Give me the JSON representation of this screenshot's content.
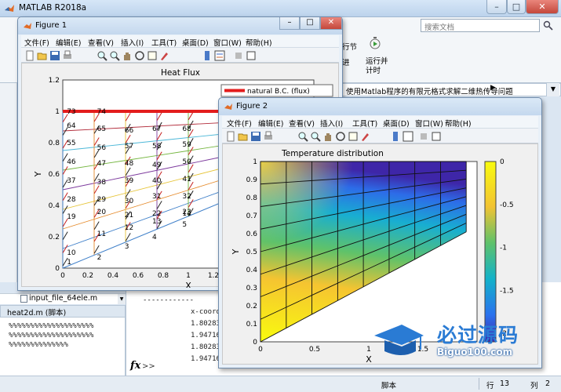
{
  "app": {
    "title": "MATLAB R2018a",
    "search_placeholder": "搜索文档",
    "ribbon_run_section": "行节",
    "ribbon_advance": "进",
    "ribbon_run_time_1": "运行并",
    "ribbon_run_time_2": "计时",
    "address_bar": "使用Matlab程序的有限元格式求解二维热传导问题",
    "file_item": "input_file_64ele.m",
    "editor_title": "heat2d.m (脚本)",
    "editor_lines": [
      "%%%%%%%%%%%%%%%%%%%%",
      "%%%%%%%%%%%%%%%%%%%%",
      "%%%%%%%%%%%%%%"
    ],
    "cmd_dashes": "------------",
    "cmd_lines": [
      "x-coord",
      "1.80283",
      "1.94716",
      "1.80283",
      "1.94716"
    ],
    "prompt": ">>",
    "status": {
      "mode": "脚本",
      "row_label": "行",
      "row": "13",
      "col_label": "列",
      "col": "2"
    }
  },
  "menus": [
    "文件(F)",
    "编辑(E)",
    "查看(V)",
    "插入(I)",
    "工具(T)",
    "桌面(D)",
    "窗口(W)",
    "帮助(H)"
  ],
  "figure1": {
    "window_title": "Figure 1",
    "chart_data": {
      "type": "quiver",
      "title": "Heat Flux",
      "xlabel": "X",
      "ylabel": "Y",
      "xlim": [
        0,
        2
      ],
      "ylim": [
        0,
        1.2
      ],
      "xticks": [
        "0",
        "0.2",
        "0.4",
        "0.6",
        "0.8",
        "1",
        "1.2"
      ],
      "yticks": [
        "0",
        "0.2",
        "0.4",
        "0.6",
        "0.8",
        "1",
        "1.2"
      ],
      "legend": [
        "natural B.C. (flux)"
      ],
      "node_labels": [
        {
          "t": "73",
          "x": 0.02,
          "y": 1.0
        },
        {
          "t": "74",
          "x": 0.26,
          "y": 1.0
        },
        {
          "t": "64",
          "x": 0.02,
          "y": 0.91
        },
        {
          "t": "65",
          "x": 0.26,
          "y": 0.89
        },
        {
          "t": "66",
          "x": 0.48,
          "y": 0.88
        },
        {
          "t": "67",
          "x": 0.7,
          "y": 0.89
        },
        {
          "t": "68",
          "x": 0.94,
          "y": 0.89
        },
        {
          "t": "55",
          "x": 0.02,
          "y": 0.8
        },
        {
          "t": "56",
          "x": 0.26,
          "y": 0.77
        },
        {
          "t": "57",
          "x": 0.48,
          "y": 0.78
        },
        {
          "t": "58",
          "x": 0.7,
          "y": 0.78
        },
        {
          "t": "59",
          "x": 0.94,
          "y": 0.79
        },
        {
          "t": "46",
          "x": 0.02,
          "y": 0.68
        },
        {
          "t": "47",
          "x": 0.26,
          "y": 0.67
        },
        {
          "t": "48",
          "x": 0.48,
          "y": 0.67
        },
        {
          "t": "49",
          "x": 0.7,
          "y": 0.66
        },
        {
          "t": "50",
          "x": 0.94,
          "y": 0.68
        },
        {
          "t": "37",
          "x": 0.02,
          "y": 0.56
        },
        {
          "t": "38",
          "x": 0.26,
          "y": 0.55
        },
        {
          "t": "39",
          "x": 0.48,
          "y": 0.56
        },
        {
          "t": "40",
          "x": 0.7,
          "y": 0.56
        },
        {
          "t": "41",
          "x": 0.94,
          "y": 0.57
        },
        {
          "t": "28",
          "x": 0.02,
          "y": 0.44
        },
        {
          "t": "29",
          "x": 0.26,
          "y": 0.44
        },
        {
          "t": "30",
          "x": 0.48,
          "y": 0.43
        },
        {
          "t": "31",
          "x": 0.7,
          "y": 0.46
        },
        {
          "t": "32",
          "x": 0.94,
          "y": 0.46
        },
        {
          "t": "19",
          "x": 0.02,
          "y": 0.33
        },
        {
          "t": "20",
          "x": 0.26,
          "y": 0.36
        },
        {
          "t": "21",
          "x": 0.48,
          "y": 0.34
        },
        {
          "t": "22",
          "x": 0.7,
          "y": 0.35
        },
        {
          "t": "23",
          "x": 0.94,
          "y": 0.36
        },
        {
          "t": "10",
          "x": 0.02,
          "y": 0.1
        },
        {
          "t": "11",
          "x": 0.26,
          "y": 0.22
        },
        {
          "t": "12",
          "x": 0.48,
          "y": 0.26
        },
        {
          "t": "13",
          "x": 0.7,
          "y": 0.3
        },
        {
          "t": "14",
          "x": 0.94,
          "y": 0.35
        },
        {
          "t": "1",
          "x": 0.02,
          "y": 0.04
        },
        {
          "t": "2",
          "x": 0.26,
          "y": 0.07
        },
        {
          "t": "3",
          "x": 0.48,
          "y": 0.14
        },
        {
          "t": "4",
          "x": 0.7,
          "y": 0.2
        },
        {
          "t": "5",
          "x": 0.94,
          "y": 0.28
        }
      ]
    }
  },
  "figure2": {
    "window_title": "Figure 2",
    "chart_data": {
      "type": "heatmap",
      "title": "Temperature distribution",
      "xlabel": "X",
      "ylabel": "Y",
      "xlim": [
        0,
        2
      ],
      "ylim": [
        0,
        1
      ],
      "xticks": [
        "0",
        "0.5",
        "1",
        "1.5"
      ],
      "yticks": [
        "0",
        "0.1",
        "0.2",
        "0.3",
        "0.4",
        "0.5",
        "0.6",
        "0.7",
        "0.8",
        "0.9",
        "1"
      ],
      "colorbar": {
        "min": -2.1,
        "max": 0,
        "ticks": [
          "0",
          "-0.5",
          "-1",
          "-1.5",
          "-2"
        ]
      },
      "colormap": "parula"
    }
  },
  "watermark": {
    "title": "必过源码",
    "subtitle": "Biguo100.com"
  }
}
